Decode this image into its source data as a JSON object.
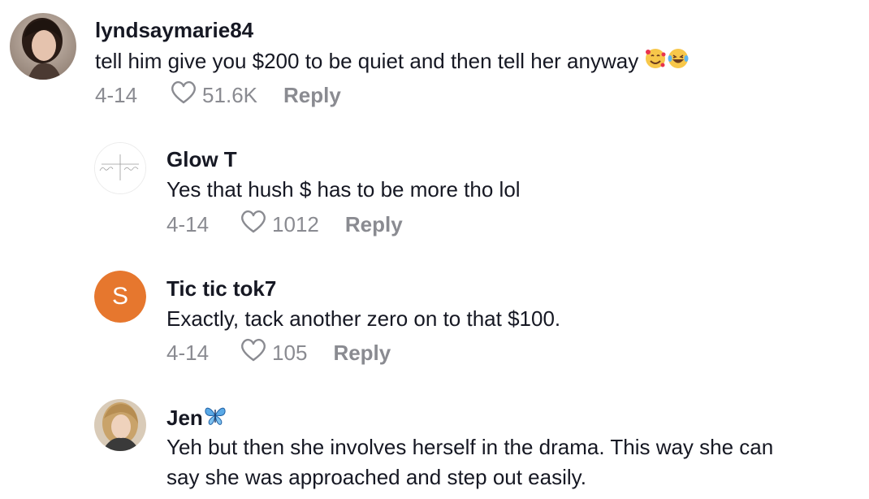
{
  "comments": [
    {
      "username": "lyndsaymarie84",
      "text": "tell him give you $200 to be quiet and then tell her anyway",
      "date": "4-14",
      "likes": "51.6K",
      "reply_label": "Reply"
    },
    {
      "username": "Glow T",
      "text": "Yes that hush $ has to be more tho lol",
      "date": "4-14",
      "likes": "1012",
      "reply_label": "Reply"
    },
    {
      "username": "Tic tic tok7",
      "avatar_letter": "S",
      "avatar_color": "#e6772e",
      "text": "Exactly, tack another zero on to that $100.",
      "date": "4-14",
      "likes": "105",
      "reply_label": "Reply"
    },
    {
      "username": "Jen",
      "text_line1": "Yeh but then she involves herself in the drama. This way she can",
      "text_line2": "say she was approached and step out easily."
    }
  ],
  "colors": {
    "primary_text": "#161823",
    "secondary_text": "#8a8b91",
    "avatar_orange": "#e6772e"
  },
  "icons": {
    "like": "heart-outline-icon",
    "emoji1": "smiling-face-with-hearts-emoji",
    "emoji2": "face-with-tears-of-joy-emoji",
    "jen_suffix": "butterfly-emoji"
  }
}
